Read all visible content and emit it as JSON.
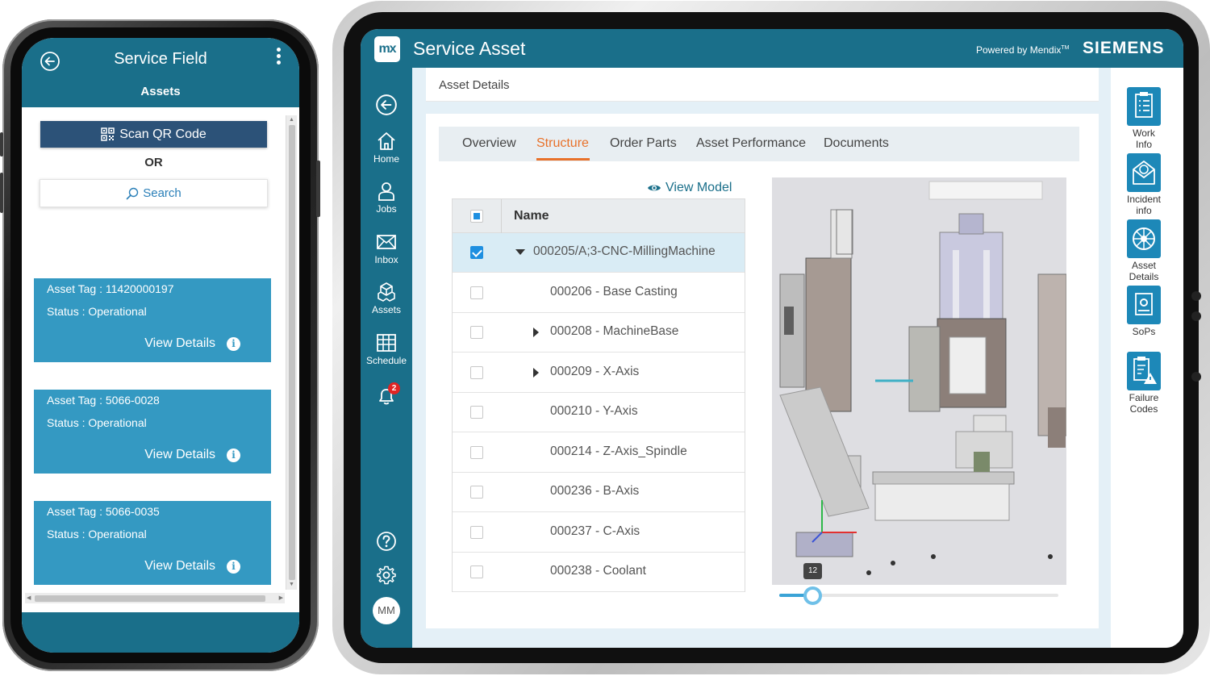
{
  "phone": {
    "title": "Service Field",
    "subtitle": "Assets",
    "scan_label": "Scan QR Code",
    "or_label": "OR",
    "search_label": "Search",
    "assets": [
      {
        "tag": "Asset Tag : 11420000197",
        "status": "Status : Operational",
        "action": "View Details"
      },
      {
        "tag": "Asset Tag : 5066-0028",
        "status": "Status : Operational",
        "action": "View Details"
      },
      {
        "tag": "Asset Tag : 5066-0035",
        "status": "Status : Operational",
        "action": "View Details"
      }
    ]
  },
  "tablet": {
    "logo": "mx",
    "title": "Service Asset",
    "powered_by": "Powered by Mendix",
    "powered_tm": "TM",
    "brand": "SIEMENS",
    "nav": {
      "home": "Home",
      "jobs": "Jobs",
      "inbox": "Inbox",
      "assets": "Assets",
      "schedule": "Schedule",
      "notification_count": "2",
      "avatar": "MM"
    },
    "right_nav": {
      "work_info": [
        "Work",
        "Info"
      ],
      "incident_info": [
        "Incident",
        "info"
      ],
      "asset_details": [
        "Asset",
        "Details"
      ],
      "sops": "SoPs",
      "failure_codes": [
        "Failure",
        "Codes"
      ]
    },
    "breadcrumb": "Asset Details",
    "tabs": [
      "Overview",
      "Structure",
      "Order Parts",
      "Asset Performance",
      "Documents"
    ],
    "active_tab": "Structure",
    "view_model": "View Model",
    "tree_header": "Name",
    "tree_rows": [
      {
        "label": "000205/A;3-CNC-MillingMachine",
        "checked": true,
        "expander": "down"
      },
      {
        "label": "000206 - Base Casting",
        "checked": false,
        "expander": "none"
      },
      {
        "label": "000208 - MachineBase",
        "checked": false,
        "expander": "right"
      },
      {
        "label": "000209 - X-Axis",
        "checked": false,
        "expander": "right"
      },
      {
        "label": "000210 - Y-Axis",
        "checked": false,
        "expander": "none"
      },
      {
        "label": "000214 - Z-Axis_Spindle",
        "checked": false,
        "expander": "none"
      },
      {
        "label": "000236 - B-Axis",
        "checked": false,
        "expander": "none"
      },
      {
        "label": "000237 - C-Axis",
        "checked": false,
        "expander": "none"
      },
      {
        "label": "000238 - Coolant",
        "checked": false,
        "expander": "none"
      }
    ],
    "slider": {
      "value": "12"
    },
    "colors": {
      "primary": "#1a6f8a",
      "accent": "#e8712a",
      "card": "#3499c2",
      "scan": "#2c5278",
      "badge": "#e02424"
    }
  }
}
